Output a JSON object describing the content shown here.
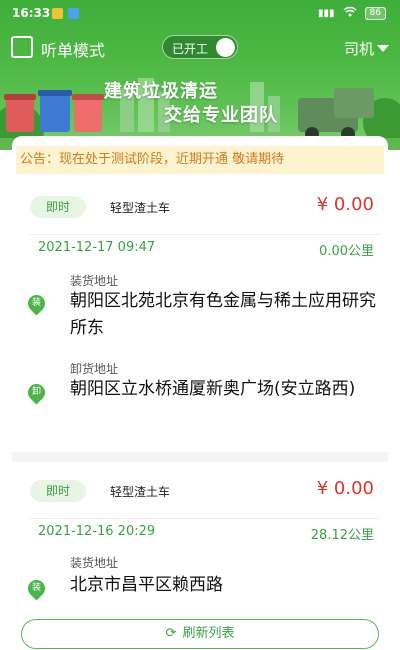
{
  "status_bar": {
    "time": "16:33",
    "signal": "▮▮▮",
    "wifi": "wifi",
    "battery": "86"
  },
  "top_bar": {
    "mode_label": "听单模式",
    "toggle_label": "已开工",
    "toggle_on": true,
    "role_label": "司机"
  },
  "banner": {
    "title": "建筑垃圾清运",
    "subtitle": "交给专业团队"
  },
  "notice": {
    "text": "公告：现在处于测试阶段，近期开通  敬请期待"
  },
  "orders": [
    {
      "when": "即时",
      "vehicle": "轻型渣土车",
      "price": "¥ 0.00",
      "datetime": "2021-12-17 09:47",
      "distance": "0.00公里",
      "load_label": "装货地址",
      "load_pin": "装",
      "load_address": "朝阳区北苑北京有色金属与稀土应用研究所东",
      "unload_label": "卸货地址",
      "unload_pin": "卸",
      "unload_address": "朝阳区立水桥通厦新奥广场(安立路西)"
    },
    {
      "when": "即时",
      "vehicle": "轻型渣土车",
      "price": "¥ 0.00",
      "datetime": "2021-12-16 20:29",
      "distance": "28.12公里",
      "load_label": "装货地址",
      "load_pin": "装",
      "load_address": "北京市昌平区赖西路"
    }
  ],
  "refresh_button": {
    "label": "刷新列表",
    "icon": "refresh-icon"
  },
  "colors": {
    "brand_green": "#4cb843",
    "price_red": "#d6372f",
    "notice_bg": "#fdf3cf",
    "notice_text": "#d17b1f"
  }
}
